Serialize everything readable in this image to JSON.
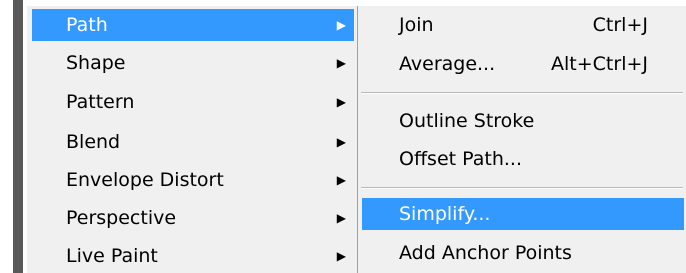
{
  "main_menu": {
    "items": [
      {
        "label": "Path",
        "arrow": "▶"
      },
      {
        "label": "Shape",
        "arrow": "▶"
      },
      {
        "label": "Pattern",
        "arrow": "▶"
      },
      {
        "label": "Blend",
        "arrow": "▶"
      },
      {
        "label": "Envelope Distort",
        "arrow": "▶"
      },
      {
        "label": "Perspective",
        "arrow": "▶"
      },
      {
        "label": "Live Paint",
        "arrow": "▶"
      }
    ]
  },
  "path_submenu": {
    "items": [
      {
        "label": "Join",
        "shortcut": "Ctrl+J"
      },
      {
        "label": "Average...",
        "shortcut": "Alt+Ctrl+J"
      },
      {
        "label": "Outline Stroke",
        "shortcut": ""
      },
      {
        "label": "Offset Path...",
        "shortcut": ""
      },
      {
        "label": "Simplify...",
        "shortcut": ""
      },
      {
        "label": "Add Anchor Points",
        "shortcut": ""
      }
    ]
  },
  "colors": {
    "highlight": "#3399ff",
    "menu_bg": "#f0f0f0"
  }
}
